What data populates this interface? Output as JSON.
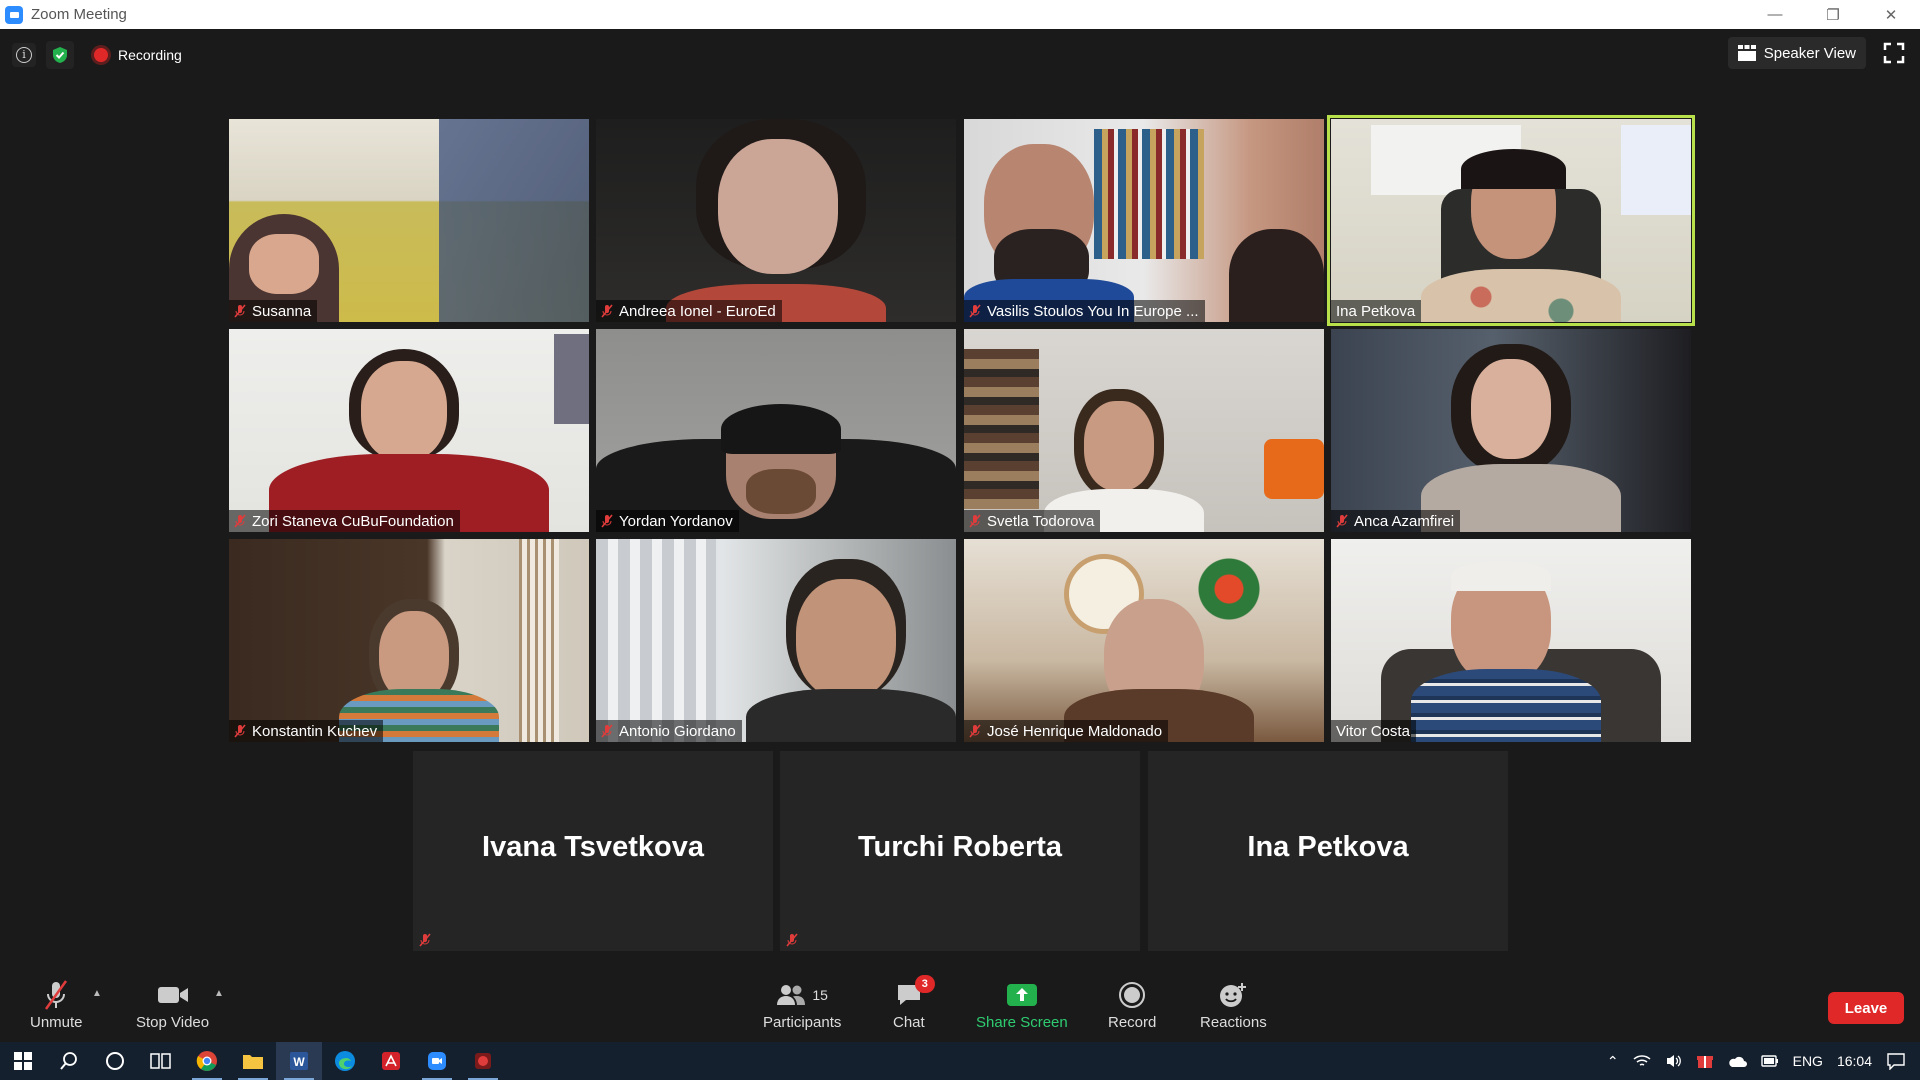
{
  "window": {
    "title": "Zoom Meeting"
  },
  "topbar": {
    "recording_label": "Recording",
    "speaker_view_label": "Speaker View"
  },
  "participants_tiles": [
    {
      "name": "Susanna",
      "muted": true
    },
    {
      "name": "Andreea Ionel - EuroEd",
      "muted": true
    },
    {
      "name": "Vasilis Stoulos You In Europe ...",
      "muted": true
    },
    {
      "name": "Ina Petkova",
      "muted": false,
      "active_speaker": true
    },
    {
      "name": "Zori Staneva CuBuFoundation",
      "muted": true
    },
    {
      "name": "Yordan Yordanov",
      "muted": true
    },
    {
      "name": "Svetla Todorova",
      "muted": true
    },
    {
      "name": "Anca Azamfirei",
      "muted": true
    },
    {
      "name": "Konstantin Kuchev",
      "muted": true
    },
    {
      "name": "Antonio Giordano",
      "muted": true
    },
    {
      "name": "José Henrique Maldonado",
      "muted": true
    },
    {
      "name": "Vitor Costa",
      "muted": false
    }
  ],
  "video_off_tiles": [
    {
      "name": "Ivana Tsvetkova",
      "muted": true
    },
    {
      "name": "Turchi Roberta",
      "muted": true
    },
    {
      "name": "Ina Petkova",
      "muted": false
    }
  ],
  "toolbar": {
    "unmute_label": "Unmute",
    "stop_video_label": "Stop Video",
    "participants_label": "Participants",
    "participants_count": "15",
    "chat_label": "Chat",
    "chat_badge": "3",
    "share_label": "Share Screen",
    "record_label": "Record",
    "reactions_label": "Reactions",
    "leave_label": "Leave"
  },
  "taskbar": {
    "language": "ENG",
    "time": "16:04"
  },
  "colors": {
    "active_speaker_border": "#b8e04a",
    "share_green": "#2ecc71",
    "leave_red": "#e02828",
    "taskbar_bg": "#15202e"
  }
}
